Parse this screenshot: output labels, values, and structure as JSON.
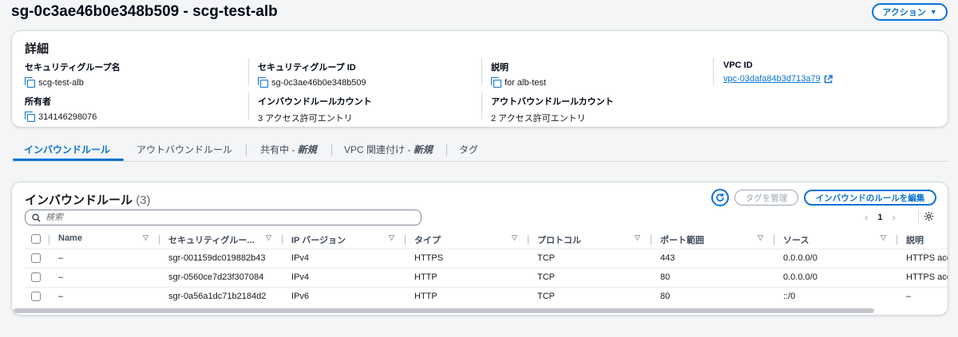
{
  "header": {
    "title": "sg-0c3ae46b0e348b509 - scg-test-alb",
    "action_label": "アクション",
    "action_caret": "▼"
  },
  "details": {
    "title": "詳細",
    "fields": [
      {
        "label": "セキュリティグループ名",
        "value": "scg-test-alb"
      },
      {
        "label": "セキュリティグループ ID",
        "value": "sg-0c3ae46b0e348b509"
      },
      {
        "label": "説明",
        "value": "for alb-test"
      },
      {
        "label": "VPC ID",
        "value": "vpc-03dafa84b3d713a79"
      },
      {
        "label": "所有者",
        "value": "314146298076"
      },
      {
        "label": "インバウンドルールカウント",
        "value": "3 アクセス許可エントリ"
      },
      {
        "label": "アウトバウンドルールカウント",
        "value": "2 アクセス許可エントリ"
      }
    ]
  },
  "tabs": {
    "inbound": "インバウンドルール",
    "outbound": "アウトバウンドルール",
    "sharing": "共有中 - ",
    "sharing_em": "新規",
    "vpc": "VPC 関連付け - ",
    "vpc_em": "新規",
    "tags": "タグ"
  },
  "rules": {
    "title": "インバウンドルール",
    "count": "(3)",
    "manage_tags_label": "タグを管理",
    "edit_label": "インバウンドのルールを編集",
    "search_placeholder": "検索",
    "page_prev": "‹",
    "page_number": "1",
    "page_next": "›",
    "columns": [
      "Name",
      "セキュリティグルー...",
      "IP バージョン",
      "タイプ",
      "プロトコル",
      "ポート範囲",
      "ソース",
      "説明"
    ],
    "rows": [
      [
        "–",
        "sgr-001159dc019882b43",
        "IPv4",
        "HTTPS",
        "TCP",
        "443",
        "0.0.0.0/0",
        "HTTPS acce"
      ],
      [
        "–",
        "sgr-0560ce7d23f307084",
        "IPv4",
        "HTTP",
        "TCP",
        "80",
        "0.0.0.0/0",
        "HTTPS acce"
      ],
      [
        "–",
        "sgr-0a56a1dc71b2184d2",
        "IPv6",
        "HTTP",
        "TCP",
        "80",
        "::/0",
        "–"
      ]
    ]
  },
  "colors": {
    "accent": "#0972d3",
    "disabled": "#9ba7b6"
  }
}
